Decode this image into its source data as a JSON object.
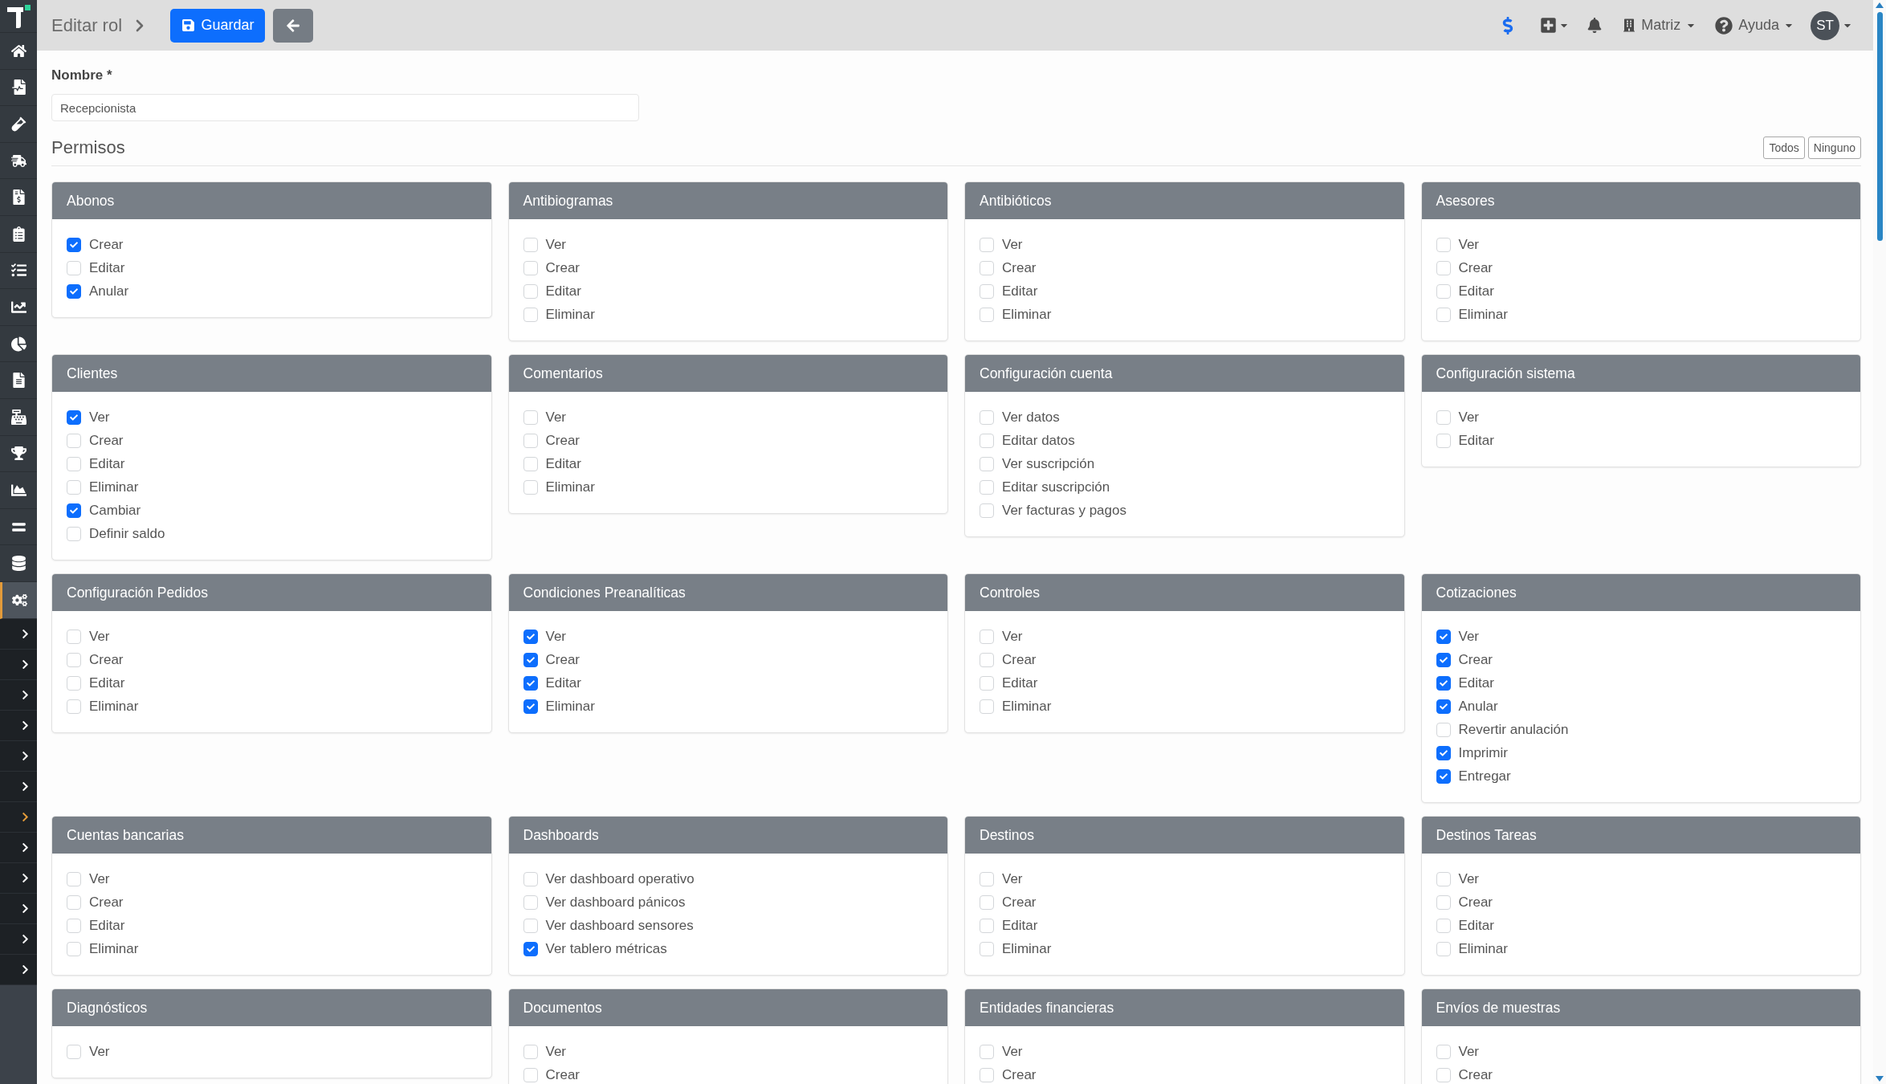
{
  "sidebar": {
    "menu": [
      {
        "selected": false
      },
      {
        "selected": false
      },
      {
        "selected": false
      },
      {
        "selected": false
      },
      {
        "selected": false
      },
      {
        "selected": false
      },
      {
        "selected": false
      },
      {
        "selected": false
      },
      {
        "selected": false
      },
      {
        "selected": false
      },
      {
        "selected": false
      },
      {
        "selected": false
      },
      {
        "selected": false
      },
      {
        "selected": false
      },
      {
        "selected": false
      },
      {
        "selected": true
      }
    ],
    "submenu": [
      {
        "selected": false
      },
      {
        "selected": false
      },
      {
        "selected": false
      },
      {
        "selected": false
      },
      {
        "selected": false
      },
      {
        "selected": false
      },
      {
        "selected": true
      },
      {
        "selected": false
      },
      {
        "selected": false
      },
      {
        "selected": false
      },
      {
        "selected": false
      },
      {
        "selected": false
      }
    ]
  },
  "topbar": {
    "title": "Editar rol",
    "save_button": "Guardar",
    "branch_menu": "Matriz",
    "help_menu": "Ayuda",
    "avatar": "ST"
  },
  "form": {
    "name_label": "Nombre *",
    "name_value": "Recepcionista"
  },
  "permissions": {
    "title": "Permisos",
    "buttons": [
      "Todos",
      "Ninguno"
    ],
    "groups": [
      {
        "title": "Abonos",
        "items": [
          {
            "label": "Crear",
            "checked": true
          },
          {
            "label": "Editar",
            "checked": false
          },
          {
            "label": "Anular",
            "checked": true
          }
        ]
      },
      {
        "title": "Antibiogramas",
        "items": [
          {
            "label": "Ver",
            "checked": false
          },
          {
            "label": "Crear",
            "checked": false
          },
          {
            "label": "Editar",
            "checked": false
          },
          {
            "label": "Eliminar",
            "checked": false
          }
        ]
      },
      {
        "title": "Antibióticos",
        "items": [
          {
            "label": "Ver",
            "checked": false
          },
          {
            "label": "Crear",
            "checked": false
          },
          {
            "label": "Editar",
            "checked": false
          },
          {
            "label": "Eliminar",
            "checked": false
          }
        ]
      },
      {
        "title": "Asesores",
        "items": [
          {
            "label": "Ver",
            "checked": false
          },
          {
            "label": "Crear",
            "checked": false
          },
          {
            "label": "Editar",
            "checked": false
          },
          {
            "label": "Eliminar",
            "checked": false
          }
        ]
      },
      {
        "title": "Clientes",
        "items": [
          {
            "label": "Ver",
            "checked": true
          },
          {
            "label": "Crear",
            "checked": false
          },
          {
            "label": "Editar",
            "checked": false
          },
          {
            "label": "Eliminar",
            "checked": false
          },
          {
            "label": "Cambiar",
            "checked": true
          },
          {
            "label": "Definir saldo",
            "checked": false
          }
        ]
      },
      {
        "title": "Comentarios",
        "items": [
          {
            "label": "Ver",
            "checked": false
          },
          {
            "label": "Crear",
            "checked": false
          },
          {
            "label": "Editar",
            "checked": false
          },
          {
            "label": "Eliminar",
            "checked": false
          }
        ]
      },
      {
        "title": "Configuración cuenta",
        "items": [
          {
            "label": "Ver datos",
            "checked": false
          },
          {
            "label": "Editar datos",
            "checked": false
          },
          {
            "label": "Ver suscripción",
            "checked": false
          },
          {
            "label": "Editar suscripción",
            "checked": false
          },
          {
            "label": "Ver facturas y pagos",
            "checked": false
          }
        ]
      },
      {
        "title": "Configuración sistema",
        "items": [
          {
            "label": "Ver",
            "checked": false
          },
          {
            "label": "Editar",
            "checked": false
          }
        ]
      },
      {
        "title": "Configuración Pedidos",
        "items": [
          {
            "label": "Ver",
            "checked": false
          },
          {
            "label": "Crear",
            "checked": false
          },
          {
            "label": "Editar",
            "checked": false
          },
          {
            "label": "Eliminar",
            "checked": false
          }
        ]
      },
      {
        "title": "Condiciones Preanalíticas",
        "items": [
          {
            "label": "Ver",
            "checked": true
          },
          {
            "label": "Crear",
            "checked": true
          },
          {
            "label": "Editar",
            "checked": true
          },
          {
            "label": "Eliminar",
            "checked": true
          }
        ]
      },
      {
        "title": "Controles",
        "items": [
          {
            "label": "Ver",
            "checked": false
          },
          {
            "label": "Crear",
            "checked": false
          },
          {
            "label": "Editar",
            "checked": false
          },
          {
            "label": "Eliminar",
            "checked": false
          }
        ]
      },
      {
        "title": "Cotizaciones",
        "items": [
          {
            "label": "Ver",
            "checked": true
          },
          {
            "label": "Crear",
            "checked": true
          },
          {
            "label": "Editar",
            "checked": true
          },
          {
            "label": "Anular",
            "checked": true
          },
          {
            "label": "Revertir anulación",
            "checked": false
          },
          {
            "label": "Imprimir",
            "checked": true
          },
          {
            "label": "Entregar",
            "checked": true
          }
        ]
      },
      {
        "title": "Cuentas bancarias",
        "items": [
          {
            "label": "Ver",
            "checked": false
          },
          {
            "label": "Crear",
            "checked": false
          },
          {
            "label": "Editar",
            "checked": false
          },
          {
            "label": "Eliminar",
            "checked": false
          }
        ]
      },
      {
        "title": "Dashboards",
        "items": [
          {
            "label": "Ver dashboard operativo",
            "checked": false
          },
          {
            "label": "Ver dashboard pánicos",
            "checked": false
          },
          {
            "label": "Ver dashboard sensores",
            "checked": false
          },
          {
            "label": "Ver tablero métricas",
            "checked": true
          }
        ]
      },
      {
        "title": "Destinos",
        "items": [
          {
            "label": "Ver",
            "checked": false
          },
          {
            "label": "Crear",
            "checked": false
          },
          {
            "label": "Editar",
            "checked": false
          },
          {
            "label": "Eliminar",
            "checked": false
          }
        ]
      },
      {
        "title": "Destinos Tareas",
        "items": [
          {
            "label": "Ver",
            "checked": false
          },
          {
            "label": "Crear",
            "checked": false
          },
          {
            "label": "Editar",
            "checked": false
          },
          {
            "label": "Eliminar",
            "checked": false
          }
        ]
      },
      {
        "title": "Diagnósticos",
        "items": [
          {
            "label": "Ver",
            "checked": false
          }
        ]
      },
      {
        "title": "Documentos",
        "items": [
          {
            "label": "Ver",
            "checked": false
          },
          {
            "label": "Crear",
            "checked": false
          }
        ]
      },
      {
        "title": "Entidades financieras",
        "items": [
          {
            "label": "Ver",
            "checked": false
          },
          {
            "label": "Crear",
            "checked": false
          }
        ]
      },
      {
        "title": "Envíos de muestras",
        "items": [
          {
            "label": "Ver",
            "checked": false
          },
          {
            "label": "Crear",
            "checked": false
          }
        ]
      }
    ]
  }
}
